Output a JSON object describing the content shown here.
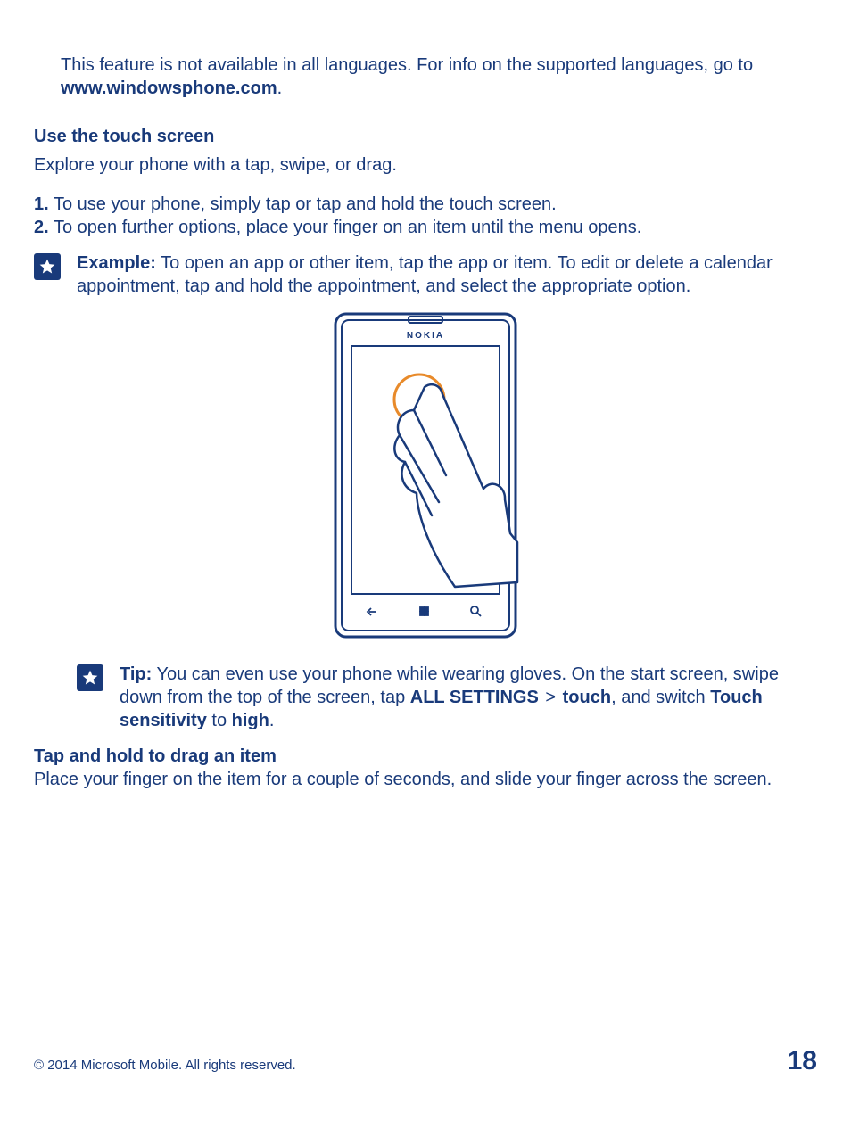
{
  "intro": {
    "text": "This feature is not available in all languages. For info on the supported languages, go to ",
    "link": "www.windowsphone.com",
    "suffix": "."
  },
  "section1": {
    "heading": "Use the touch screen",
    "body": "Explore your phone with a tap, swipe, or drag.",
    "steps": [
      {
        "num": "1.",
        "text": "To use your phone, simply tap or tap and hold the touch screen."
      },
      {
        "num": "2.",
        "text": "To open further options, place your finger on an item until the menu opens."
      }
    ]
  },
  "example": {
    "label": "Example:",
    "text": " To open an app or other item, tap the app or item. To edit or delete a calendar appointment, tap and hold the appointment, and select the appropriate option."
  },
  "figure": {
    "brand": "NOKIA"
  },
  "tip": {
    "label": "Tip:",
    "text_a": " You can even use your phone while wearing gloves. On the start screen, swipe down from the top of the screen, tap ",
    "b1": "ALL SETTINGS",
    "sep": " > ",
    "b2": "touch",
    "text_b": ", and switch ",
    "b3": "Touch sensitivity",
    "text_c": " to ",
    "b4": "high",
    "text_d": "."
  },
  "section2": {
    "heading": "Tap and hold to drag an item",
    "body": "Place your finger on the item for a couple of seconds, and slide your finger across the screen."
  },
  "footer": {
    "copyright": "© 2014 Microsoft Mobile. All rights reserved.",
    "page": "18"
  }
}
